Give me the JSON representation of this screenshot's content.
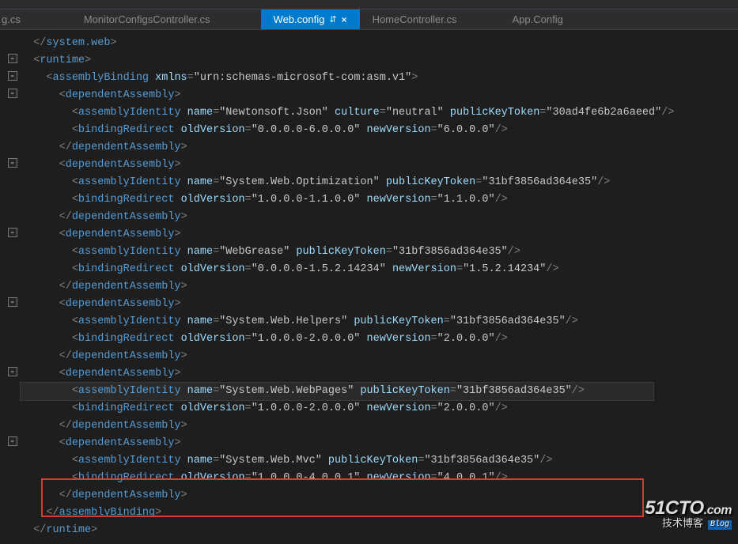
{
  "tabs": {
    "partial": "g.cs",
    "items": [
      {
        "label": "MonitorConfigsController.cs",
        "active": false
      },
      {
        "label": "Web.config",
        "active": true,
        "pinned": true
      },
      {
        "label": "HomeController.cs",
        "active": false
      },
      {
        "label": "App.Config",
        "active": false
      }
    ]
  },
  "code": {
    "xmlns_val": "urn:schemas-microsoft-com:asm.v1",
    "deps": [
      {
        "name": "Newtonsoft.Json",
        "culture": "neutral",
        "publicKeyToken": "30ad4fe6b2a6aeed",
        "oldVersion": "0.0.0.0-6.0.0.0",
        "newVersion": "6.0.0.0",
        "highlight": false
      },
      {
        "name": "System.Web.Optimization",
        "publicKeyToken": "31bf3856ad364e35",
        "oldVersion": "1.0.0.0-1.1.0.0",
        "newVersion": "1.1.0.0",
        "highlight": false
      },
      {
        "name": "WebGrease",
        "publicKeyToken": "31bf3856ad364e35",
        "oldVersion": "0.0.0.0-1.5.2.14234",
        "newVersion": "1.5.2.14234",
        "highlight": false
      },
      {
        "name": "System.Web.Helpers",
        "publicKeyToken": "31bf3856ad364e35",
        "oldVersion": "1.0.0.0-2.0.0.0",
        "newVersion": "2.0.0.0",
        "highlight": false
      },
      {
        "name": "System.Web.WebPages",
        "publicKeyToken": "31bf3856ad364e35",
        "oldVersion": "1.0.0.0-2.0.0.0",
        "newVersion": "2.0.0.0",
        "highlight": true
      },
      {
        "name": "System.Web.Mvc",
        "publicKeyToken": "31bf3856ad364e35",
        "oldVersion": "1.0.0.0-4.0.0.1",
        "newVersion": "4.0.0.1",
        "highlight": false
      }
    ],
    "tag_system_web": "system.web",
    "tag_runtime": "runtime",
    "tag_assemblyBinding": "assemblyBinding",
    "attr_xmlns": "xmlns",
    "tag_dependentAssembly": "dependentAssembly",
    "tag_assemblyIdentity": "assemblyIdentity",
    "attr_name": "name",
    "attr_culture": "culture",
    "attr_publicKeyToken": "publicKeyToken",
    "tag_bindingRedirect": "bindingRedirect",
    "attr_oldVersion": "oldVersion",
    "attr_newVersion": "newVersion"
  },
  "watermark": {
    "line1a": "51CTO",
    "line1b": ".com",
    "line2a": "技术博客",
    "line2b": "Blog"
  }
}
